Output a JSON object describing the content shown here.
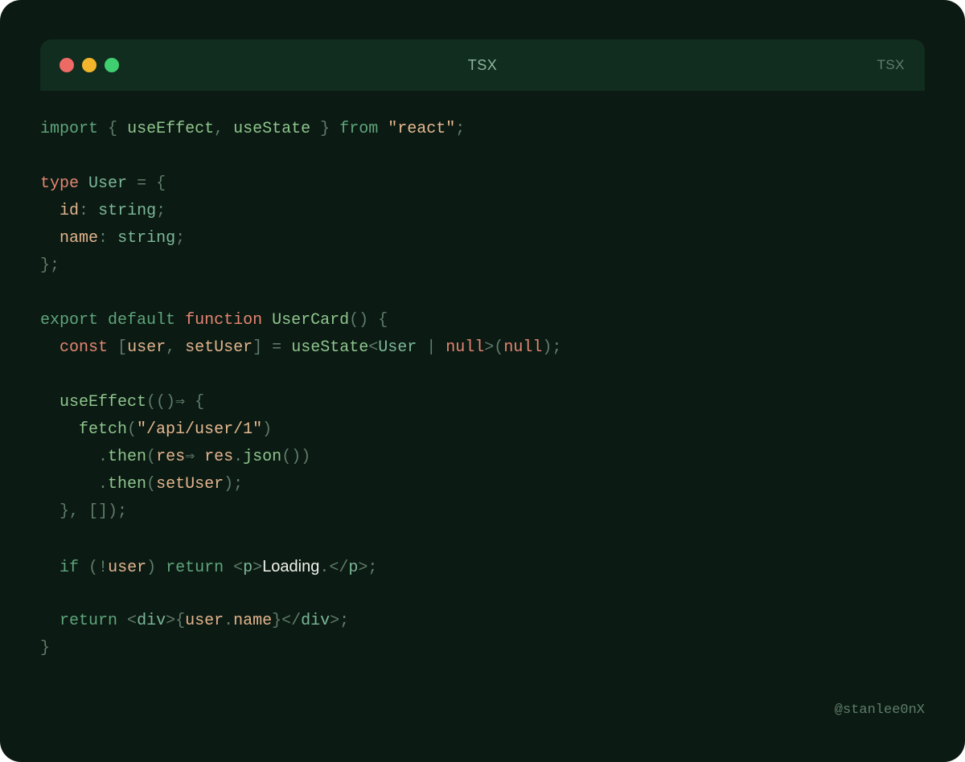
{
  "window": {
    "title": "TSX",
    "language_label": "TSX",
    "traffic_lights": {
      "close_color": "#ee6a64",
      "minimize_color": "#f3b52b",
      "zoom_color": "#3fcf70"
    }
  },
  "code": {
    "lines": [
      "import { useEffect, useState } from \"react\";",
      "",
      "type User = {",
      "  id: string;",
      "  name: string;",
      "};",
      "",
      "export default function UserCard() {",
      "  const [user, setUser] = useState<User | null>(null);",
      "",
      "  useEffect(()⇒ {",
      "    fetch(\"/api/user/1\")",
      "      .then(res⇒ res.json())",
      "      .then(setUser);",
      "  }, []);",
      "",
      "  if (!user) return <p>Loading.</p>;",
      "",
      "  return <div>{user.name}</div>;",
      "}"
    ]
  },
  "footer": {
    "signature": "@stanlee0nX"
  },
  "colors": {
    "background": "#0b1a12",
    "titlebar": "#112d1f",
    "keyword": "#5fa57c",
    "keyword_alt": "#e58673",
    "string": "#e7b992",
    "variable": "#e2b48e",
    "plain": "#6b8a78"
  }
}
